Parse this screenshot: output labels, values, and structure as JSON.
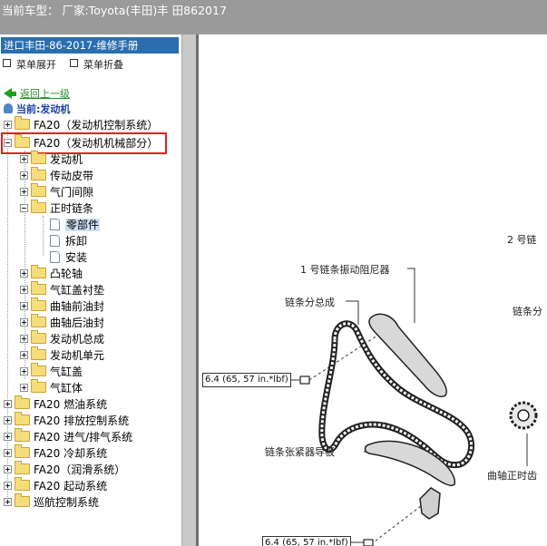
{
  "topbar": {
    "title": "当前车型：   厂家:Toyota(丰田)丰 田862017"
  },
  "sidebar": {
    "manual_title": "进口丰田-86-2017-维修手册",
    "expand_all": "菜单展开",
    "collapse_all": "菜单折叠",
    "back_link": "返回上一级",
    "current": "当前:发动机",
    "tree": [
      {
        "label": "FA20（发动机控制系统）"
      },
      {
        "label": "FA20（发动机机械部分）"
      },
      {
        "label": "发动机"
      },
      {
        "label": "传动皮带"
      },
      {
        "label": "气门间隙"
      },
      {
        "label": "正时链条"
      },
      {
        "label": "零部件"
      },
      {
        "label": "拆卸"
      },
      {
        "label": "安装"
      },
      {
        "label": "凸轮轴"
      },
      {
        "label": "气缸盖衬垫"
      },
      {
        "label": "曲轴前油封"
      },
      {
        "label": "曲轴后油封"
      },
      {
        "label": "发动机总成"
      },
      {
        "label": "发动机单元"
      },
      {
        "label": "气缸盖"
      },
      {
        "label": "气缸体"
      },
      {
        "label": "FA20 燃油系统"
      },
      {
        "label": "FA20 排放控制系统"
      },
      {
        "label": "FA20 进气/排气系统"
      },
      {
        "label": "FA20 冷却系统"
      },
      {
        "label": "FA20（润滑系统）"
      },
      {
        "label": "FA20 起动系统"
      },
      {
        "label": "巡航控制系统"
      }
    ]
  },
  "diagram": {
    "labels": {
      "chain_no2": "2 号链",
      "damper_no1": "1 号链条振动阻尼器",
      "chain_sub": "链条分总成",
      "chain_sub2": "链条分",
      "torque1": "6.4 (65, 57 in.*lbf)",
      "tensioner_guide": "链条张紧器导板",
      "crank_sprocket": "曲轴正时齿",
      "torque2": "6.4 (65, 57 in.*lbf)"
    }
  }
}
